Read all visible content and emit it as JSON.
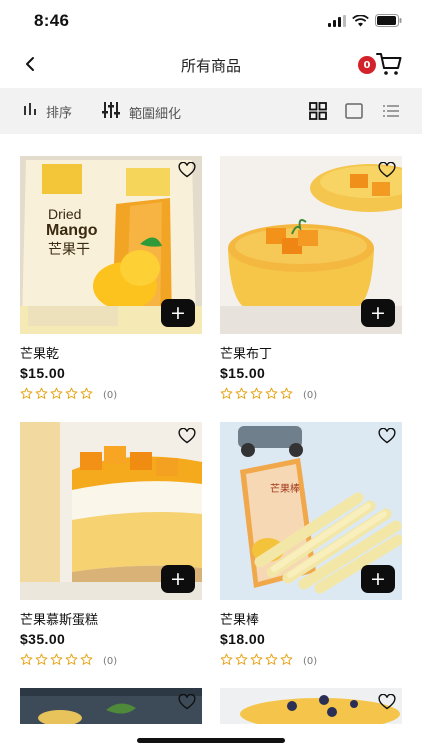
{
  "status": {
    "time": "8:46",
    "icons": [
      "signal-icon",
      "wifi-icon",
      "battery-icon"
    ]
  },
  "nav": {
    "title": "所有商品",
    "cart_count": "0",
    "icons": [
      "back-chevron-icon",
      "cart-icon"
    ]
  },
  "filter": {
    "sort_label": "排序",
    "refine_label": "範圍細化",
    "views": [
      "grid-view-icon",
      "single-view-icon",
      "list-view-icon"
    ]
  },
  "products": [
    {
      "name": "芒果乾",
      "price": "$15.00",
      "rating_count": "(0)",
      "stars": 0,
      "image": "dried-mango-bag"
    },
    {
      "name": "芒果布丁",
      "price": "$15.00",
      "rating_count": "(0)",
      "stars": 0,
      "image": "mango-pudding"
    },
    {
      "name": "芒果慕斯蛋糕",
      "price": "$35.00",
      "rating_count": "(0)",
      "stars": 0,
      "image": "mango-mousse-cake"
    },
    {
      "name": "芒果棒",
      "price": "$18.00",
      "rating_count": "(0)",
      "stars": 0,
      "image": "mango-sticks"
    }
  ],
  "product_art": {
    "bag_text_top": "Dried",
    "bag_text_main": "Mango",
    "bag_text_cn": "芒果干",
    "sticks_pack_label": "芒果棒"
  },
  "colors": {
    "accent_star": "#e8a317",
    "badge_red": "#d3222a",
    "filter_bar_bg": "#f2f2f2",
    "button_black": "#0d0d0d"
  }
}
